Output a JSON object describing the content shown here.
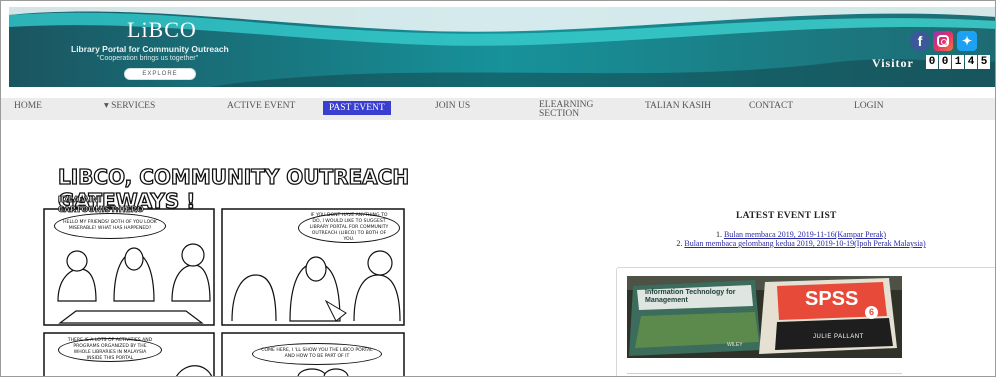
{
  "header": {
    "logo": "LiBCO",
    "tagline": "Library Portal for Community Outreach",
    "motto": "\"Cooperation brings us together\"",
    "explore_label": "EXPLORE",
    "social": [
      "facebook-icon",
      "instagram-icon",
      "twitter-icon"
    ],
    "visitor_label": "Visitor",
    "visitor_digits": [
      "0",
      "0",
      "1",
      "4",
      "5"
    ],
    "colors": {
      "banner_dark": "#1b5a63",
      "banner_light": "#2bb3b8",
      "accent": "#3a3fd0"
    }
  },
  "nav": {
    "items": [
      {
        "label": "HOME"
      },
      {
        "label": "▾ SERVICES"
      },
      {
        "label": "ACTIVE EVENT"
      },
      {
        "label": "PAST EVENT",
        "active": true
      },
      {
        "label": "JOIN US"
      },
      {
        "label": "ELEARNING SECTION"
      },
      {
        "label": "TALIAN KASIH"
      },
      {
        "label": "CONTACT"
      },
      {
        "label": "LOGIN"
      }
    ]
  },
  "comic": {
    "title": "LIBCO, COMMUNITY OUTREACH GATEWAYS !",
    "credit_line1": "IDEA:AINI",
    "credit_line2": "CARTOONIST:HERO",
    "bubble1": "HELLO MY FRIENDS! BOTH OF YOU LOOK MISERABLE! WHAT HAS HAPPENED?",
    "bubble2": "IF YOU DONT HAVE ANYTHING TO DO, I WOULD LIKE TO SUGGEST LIBRARY PORTAL FOR COMMUNITY OUTREACH (LIBCO) TO BOTH OF YOU.",
    "bubble3": "THERE IS A LOTS OF ACTIVITIES AND PROGRAMS ORGANIZED BY THE WHOLE LIBRARIES IN MALAYSIA INSIDE THIS PORTAL",
    "bubble4": "COME HERE, I 'LL SHOW YOU THE LIBCO PORTAL AND HOW TO BE PART OF IT"
  },
  "events": {
    "title": "LATEST EVENT LIST",
    "items": [
      {
        "num": "1.",
        "text": "Bulan membaca 2019, 2019-11-16(Kampar Perak)"
      },
      {
        "num": "2.",
        "text": "Bulan membaca gelombang kedua 2019, 2019-10-19(Ipoh Perak Malaysia)"
      }
    ]
  },
  "photo": {
    "book1_title": "Information Technology for Management",
    "book1_author": "WILEY",
    "book2_title": "SPSS",
    "book2_badge": "6",
    "book2_author": "JULIE PALLANT"
  }
}
